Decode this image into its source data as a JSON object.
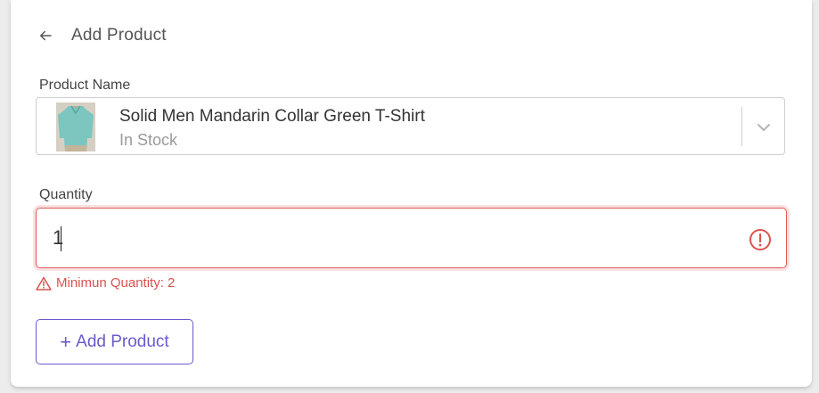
{
  "header": {
    "title": "Add Product",
    "back_icon": "arrow-left-icon"
  },
  "product_field": {
    "label": "Product Name",
    "selected": {
      "name": "Solid Men Mandarin Collar Green T-Shirt",
      "status": "In Stock",
      "thumbnail": "green-tshirt-image"
    },
    "dropdown_icon": "chevron-down-icon"
  },
  "quantity_field": {
    "label": "Quantity",
    "value": "1",
    "state": "error",
    "error_icon": "exclamation-circle-icon",
    "error_message": "Minimun Quantity: 2",
    "error_message_icon": "warning-triangle-icon"
  },
  "submit": {
    "label": "Add Product",
    "icon": "plus-icon"
  },
  "colors": {
    "accent": "#6a5acd",
    "error": "#d9534f",
    "text": "#333333",
    "muted": "#9a9a9a",
    "border": "#cfcfcf"
  }
}
